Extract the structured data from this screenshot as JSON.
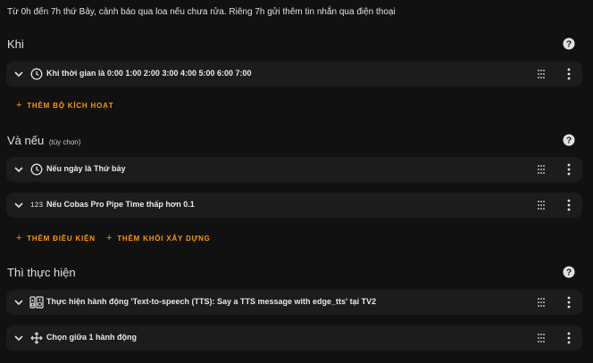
{
  "description": "Từ 0h đến 7h thứ Bảy, cảnh báo qua loa nếu chưa rửa. Riêng 7h gửi thêm tin nhắn qua điện thoại",
  "sections": {
    "when": {
      "title": "Khi",
      "triggers": [
        {
          "icon": "clock-icon",
          "label": "Khi thời gian là 0:00  1:00  2:00  3:00  4:00  5:00  6:00  7:00"
        }
      ],
      "add_label": "THÊM BỘ KÍCH HOẠT"
    },
    "and_if": {
      "title": "Và nếu",
      "optional": "(tùy chọn)",
      "conditions": [
        {
          "icon": "clock-icon",
          "label": "Nếu ngày là Thứ bảy"
        },
        {
          "icon": "numeric-icon",
          "icon_text": "123",
          "label": "Nếu Cobas Pro Pipe Time thấp hơn 0.1"
        }
      ],
      "add_condition_label": "THÊM ĐIỀU KIỆN",
      "add_block_label": "THÊM KHỐI XÂY DỰNG"
    },
    "then": {
      "title": "Thì thực hiện",
      "actions": [
        {
          "icon": "speaker-icon",
          "label": "Thực hiện hành động 'Text-to-speech (TTS): Say a TTS message with edge_tts' tại TV2"
        },
        {
          "icon": "choose-icon",
          "label": "Chọn giữa 1 hành động"
        }
      ]
    }
  },
  "colors": {
    "background": "#111111",
    "card": "#1c1c1c",
    "accent": "#ff9800",
    "text": "#e1e1e1"
  }
}
